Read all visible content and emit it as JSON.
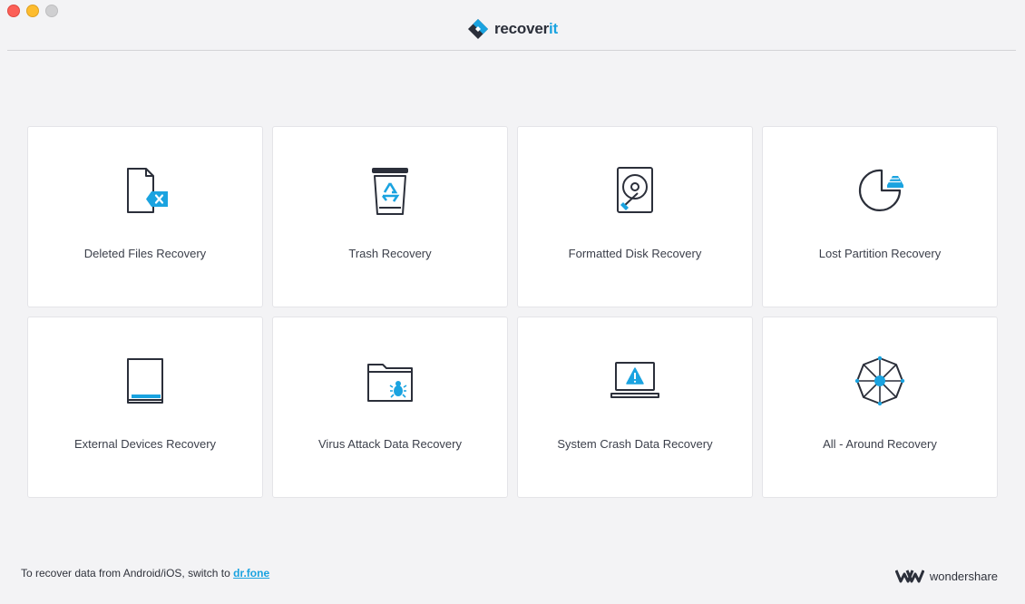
{
  "window": {
    "brand_prefix": "recover",
    "brand_suffix": "it",
    "brand_accent": "#1aa3e0"
  },
  "cards": [
    {
      "label": "Deleted Files Recovery",
      "icon": "deleted-file-icon"
    },
    {
      "label": "Trash Recovery",
      "icon": "trash-recycle-icon"
    },
    {
      "label": "Formatted Disk Recovery",
      "icon": "hard-disk-icon"
    },
    {
      "label": "Lost Partition Recovery",
      "icon": "partition-pie-icon"
    },
    {
      "label": "External Devices Recovery",
      "icon": "external-device-icon"
    },
    {
      "label": "Virus Attack Data Recovery",
      "icon": "virus-folder-icon"
    },
    {
      "label": "System Crash Data Recovery",
      "icon": "crashed-laptop-icon"
    },
    {
      "label": "All - Around Recovery",
      "icon": "all-around-icon"
    }
  ],
  "footer": {
    "text": "To recover data from Android/iOS, switch to ",
    "link": "dr.fone",
    "company": "wondershare"
  }
}
